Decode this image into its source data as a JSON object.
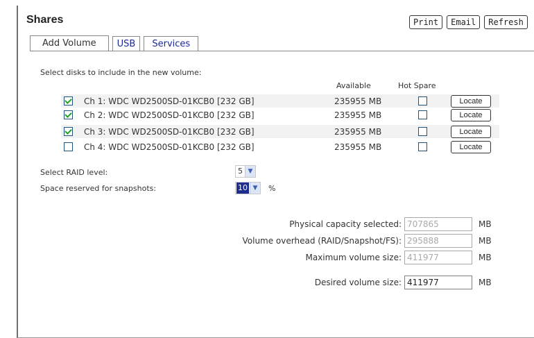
{
  "page": {
    "title": "Shares"
  },
  "toolbar": {
    "print_label": "Print",
    "email_label": "Email",
    "refresh_label": "Refresh"
  },
  "tabs": [
    {
      "label": "Add Volume",
      "active": true
    },
    {
      "label": "USB",
      "active": false
    },
    {
      "label": "Services",
      "active": false
    }
  ],
  "form": {
    "prompt": "Select disks to include in the new volume:",
    "col_available": "Available",
    "col_hot_spare": "Hot Spare",
    "disks": [
      {
        "label": "Ch 1: WDC WD2500SD-01KCB0 [232 GB]",
        "available": "235955 MB",
        "selected": true,
        "hot_spare": false,
        "locate_label": "Locate"
      },
      {
        "label": "Ch 2: WDC WD2500SD-01KCB0 [232 GB]",
        "available": "235955 MB",
        "selected": true,
        "hot_spare": false,
        "locate_label": "Locate"
      },
      {
        "label": "Ch 3: WDC WD2500SD-01KCB0 [232 GB]",
        "available": "235955 MB",
        "selected": true,
        "hot_spare": false,
        "locate_label": "Locate"
      },
      {
        "label": "Ch 4: WDC WD2500SD-01KCB0 [232 GB]",
        "available": "235955 MB",
        "selected": false,
        "hot_spare": false,
        "locate_label": "Locate"
      }
    ],
    "raid_label": "Select RAID level:",
    "raid_value": "5",
    "snapshot_label": "Space reserved for snapshots:",
    "snapshot_value": "10",
    "snapshot_unit": "%",
    "physical_label": "Physical capacity selected:",
    "physical_value": "707865",
    "overhead_label": "Volume overhead (RAID/Snapshot/FS):",
    "overhead_value": "295888",
    "max_label": "Maximum volume size:",
    "max_value": "411977",
    "desired_label": "Desired volume size:",
    "desired_value": "411977",
    "unit": "MB"
  },
  "colors": {
    "tab_link": "#1a2a9e",
    "check": "#21a121",
    "select_highlight": "#1f2f90"
  }
}
